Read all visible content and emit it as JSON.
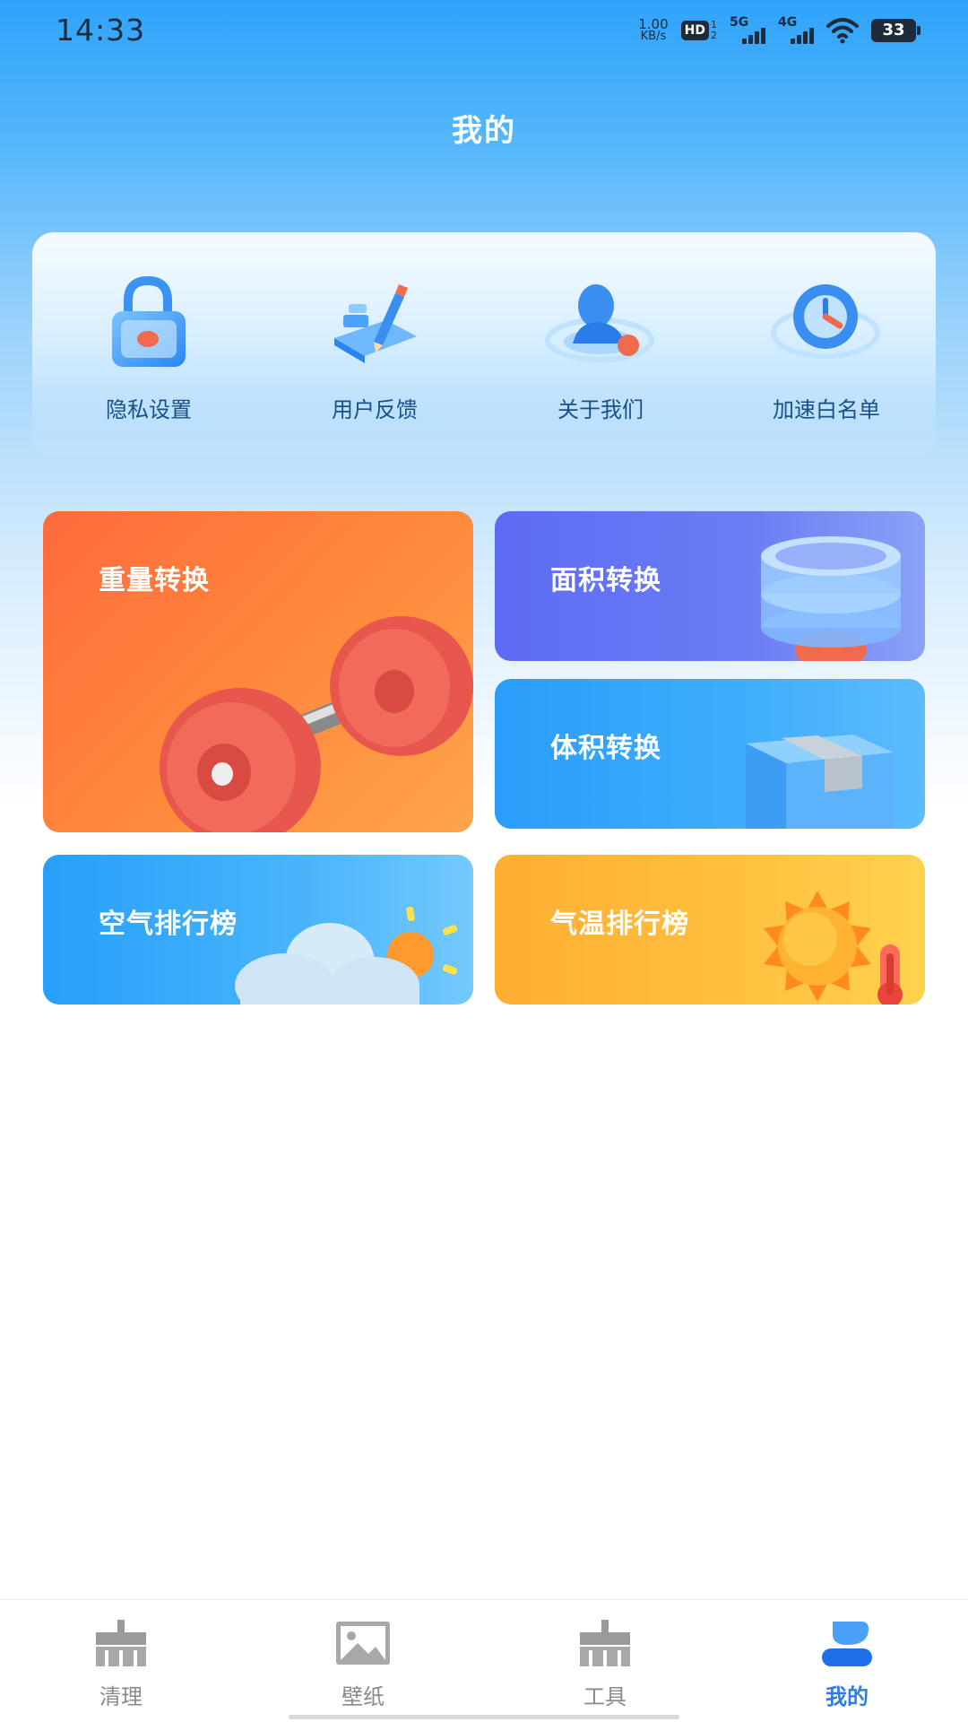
{
  "status_bar": {
    "time": "14:33",
    "net_speed_value": "1.00",
    "net_speed_unit": "KB/s",
    "hd_label": "HD",
    "hd_sub_top": "1",
    "hd_sub_bottom": "2",
    "signal1_label": "5G",
    "signal2_label": "4G",
    "battery": "33"
  },
  "header": {
    "title": "我的"
  },
  "quick_menu": {
    "items": [
      {
        "label": "隐私设置",
        "icon": "lock-icon"
      },
      {
        "label": "用户反馈",
        "icon": "feedback-pen-icon"
      },
      {
        "label": "关于我们",
        "icon": "person-icon"
      },
      {
        "label": "加速白名单",
        "icon": "speed-clock-icon"
      }
    ]
  },
  "cards": {
    "weight": {
      "title": "重量转换",
      "icon": "dumbbell-icon"
    },
    "area": {
      "title": "面积转换",
      "icon": "layers-icon"
    },
    "volume": {
      "title": "体积转换",
      "icon": "box-icon"
    },
    "air": {
      "title": "空气排行榜",
      "icon": "cloud-sun-icon"
    },
    "temp": {
      "title": "气温排行榜",
      "icon": "sun-thermometer-icon"
    }
  },
  "bottom_nav": {
    "items": [
      {
        "label": "清理",
        "icon": "broom-icon"
      },
      {
        "label": "壁纸",
        "icon": "image-icon"
      },
      {
        "label": "工具",
        "icon": "toolkit-icon"
      },
      {
        "label": "我的",
        "icon": "profile-icon"
      }
    ],
    "active_index": 3,
    "active_color": "#2b7cf0",
    "inactive_color": "#8a8a8a"
  }
}
